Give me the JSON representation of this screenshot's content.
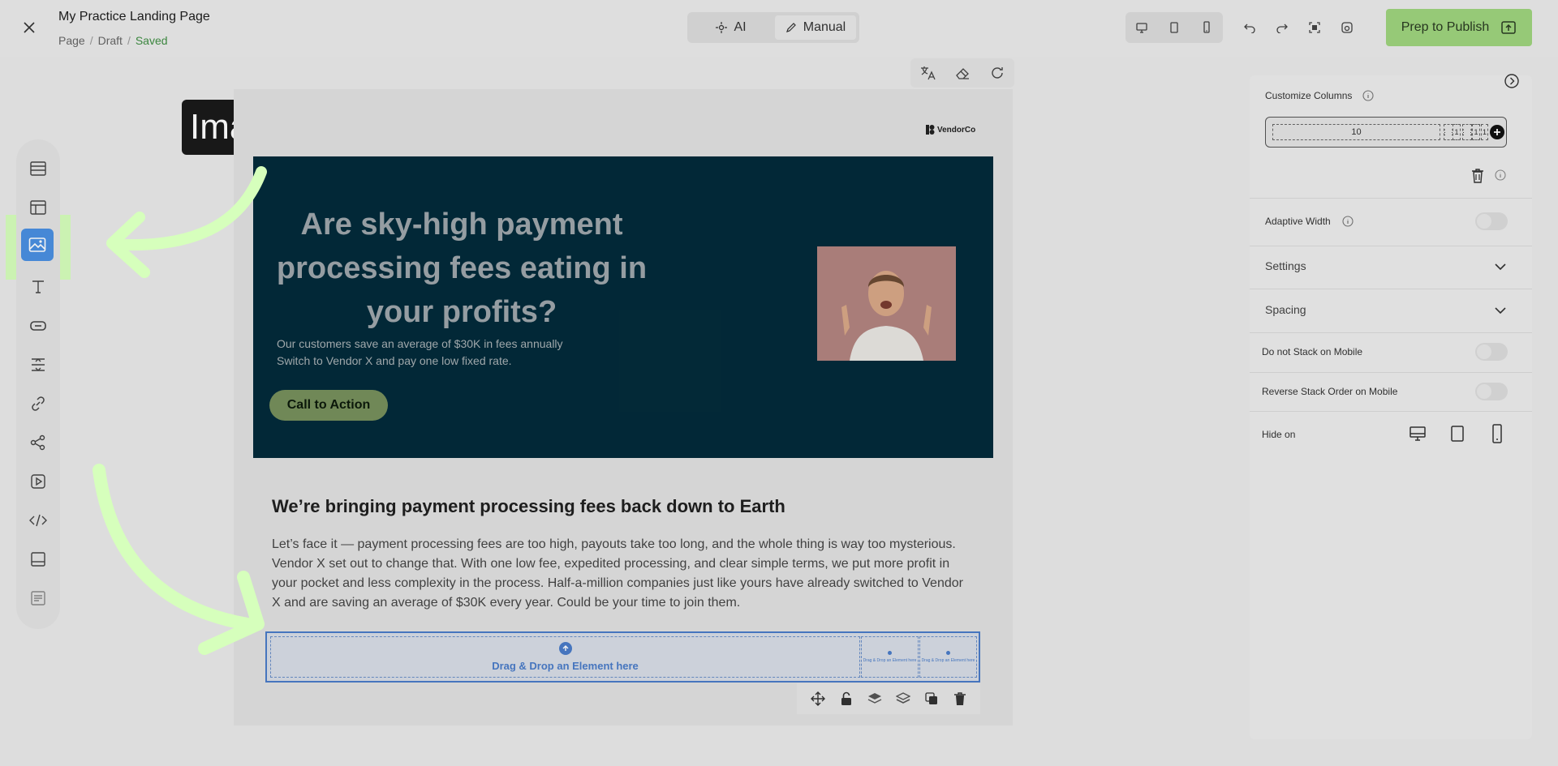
{
  "header": {
    "title": "My Practice Landing Page",
    "breadcrumb": [
      "Page",
      "Draft",
      "Saved"
    ],
    "mode": {
      "ai_label": "AI",
      "manual_label": "Manual"
    },
    "publish_label": "Prep to Publish"
  },
  "callout": {
    "text": "Image Element"
  },
  "page": {
    "logo_text": "VendorCo",
    "hero": {
      "title": "Are sky-high payment processing fees eating in your profits?",
      "subtitle_line1": "Our customers save an average of $30K in fees annually",
      "subtitle_line2": "Switch to Vendor X and pay one low fixed rate.",
      "cta_label": "Call to Action"
    },
    "section": {
      "title": "We’re bringing payment processing fees back down to Earth",
      "body": "Let’s face it — payment processing fees are too high, payouts take too long, and the whole thing is way too mysterious. Vendor X set out to change that. With one low fee, expedited processing, and clear simple terms, we put more profit in your pocket and less complexity in the process. Half-a-million companies just like yours have already switched to Vendor X and are saving an average of $30K every year. Could be your time to join them."
    },
    "dropzone": {
      "main_label": "Drag & Drop an Element here",
      "small_label": "Drag & Drop an Element here"
    }
  },
  "panel": {
    "customize_columns_label": "Customize Columns",
    "columns_value": "10",
    "mini_cols": [
      "1",
      "1",
      "1"
    ],
    "adaptive_width_label": "Adaptive Width",
    "settings_label": "Settings",
    "spacing_label": "Spacing",
    "no_stack_label": "Do not Stack on Mobile",
    "reverse_stack_label": "Reverse Stack Order on Mobile",
    "hide_on_label": "Hide on"
  },
  "colors": {
    "publish": "#9fd47e",
    "hero_bg": "#032b3a",
    "cta": "#77905c",
    "accent_blue": "#4a90e2",
    "highlight": "#d6ffbc",
    "saved_green": "#3f8e43"
  }
}
